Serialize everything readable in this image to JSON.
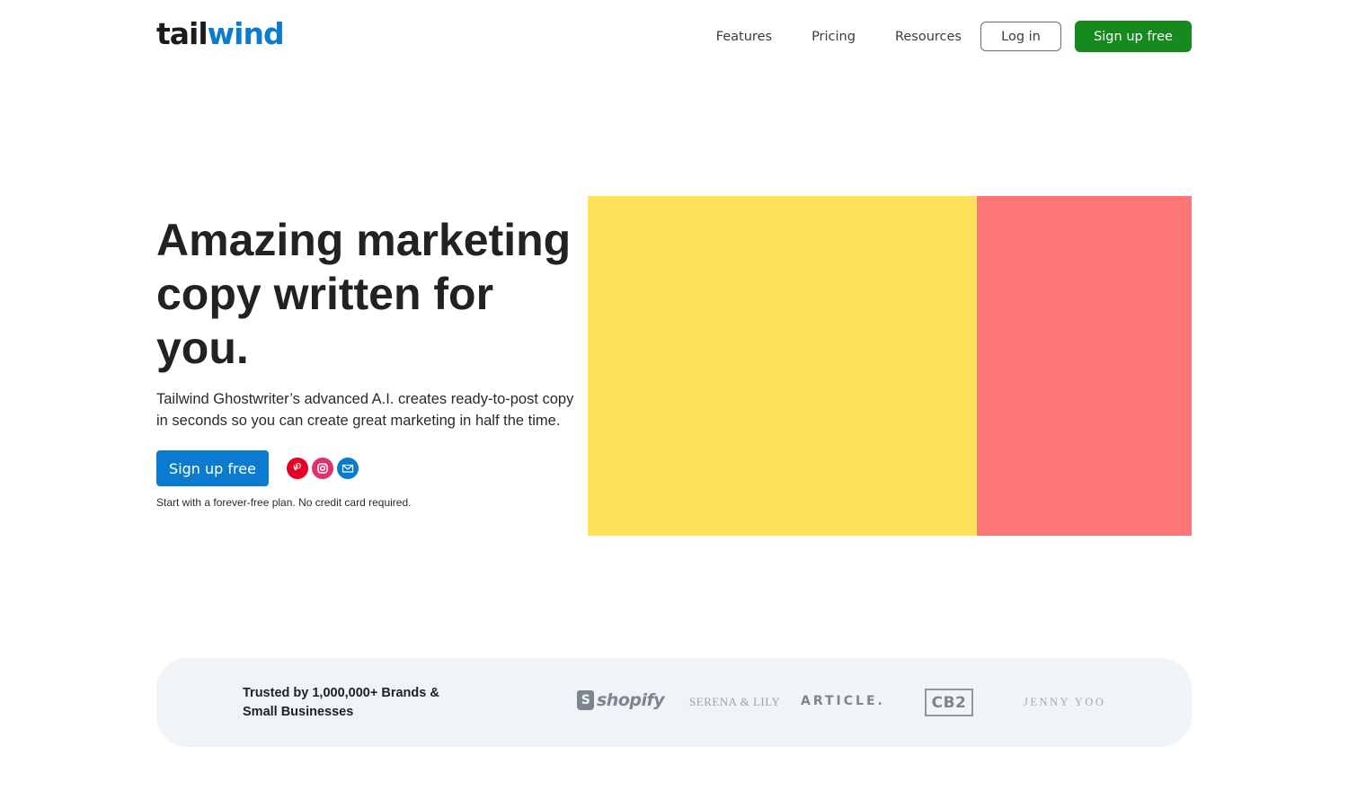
{
  "header": {
    "logo": {
      "part1": "tail",
      "part2": "wind"
    },
    "nav": [
      {
        "label": "Features"
      },
      {
        "label": "Pricing"
      },
      {
        "label": "Resources"
      }
    ],
    "login_label": "Log in",
    "signup_label": "Sign up free"
  },
  "hero": {
    "title": "Amazing marketing copy written for you.",
    "subtitle": "Tailwind Ghostwriter’s advanced A.I. creates ready-to-post copy in seconds so you can create great marketing in half the time.",
    "cta_label": "Sign up free",
    "social_icons": [
      "pinterest-icon",
      "instagram-icon",
      "mail-icon"
    ],
    "note": "Start with a forever-free plan. No credit card required.",
    "visual_colors": {
      "left": "#ffe15a",
      "right": "#ff7676"
    }
  },
  "trust": {
    "text": "Trusted by 1,000,000+ Brands & Small Businesses",
    "brands": [
      "shopify",
      "SERENA & LILY",
      "ARTICLE.",
      "CB2",
      "JENNY YOO"
    ]
  },
  "colors": {
    "brand_blue": "#0b7bd0",
    "nav_signup_green": "#168a1e",
    "trust_band_bg": "#f1f4f7"
  }
}
